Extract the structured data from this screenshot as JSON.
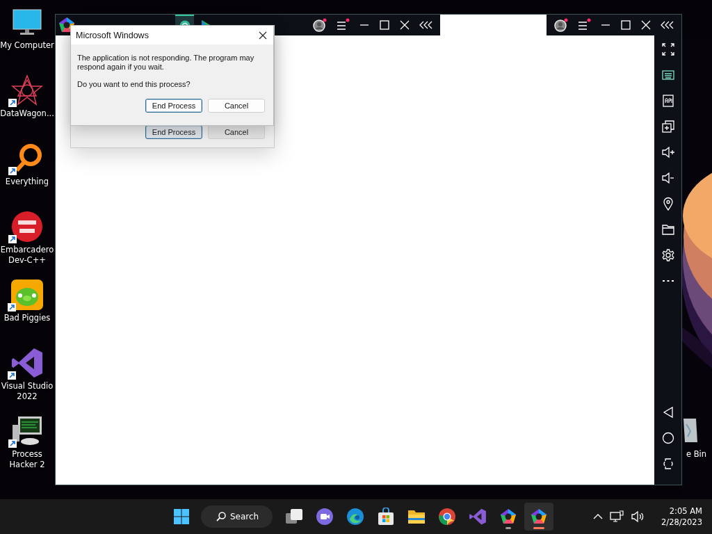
{
  "desktop_icons": [
    {
      "kind": "computer",
      "label": "My Computer",
      "shortcut": false
    },
    {
      "kind": "star",
      "label": "DataWagon...",
      "shortcut": true
    },
    {
      "kind": "magnifier",
      "label": "Everything",
      "shortcut": true
    },
    {
      "kind": "devcpp",
      "label": "Embarcadero Dev-C++",
      "shortcut": true
    },
    {
      "kind": "pig",
      "label": "Bad Piggies",
      "shortcut": true
    },
    {
      "kind": "vs",
      "label": "Visual Studio 2022",
      "shortcut": true
    },
    {
      "kind": "monitor",
      "label": "Process Hacker 2",
      "shortcut": true
    }
  ],
  "recycle_bin": {
    "label": "e Bin"
  },
  "emulator": {
    "tabs": [
      {
        "kind": "app",
        "selected": true
      },
      {
        "kind": "store",
        "selected": false
      }
    ],
    "notifications": {
      "account": true,
      "menu": true
    }
  },
  "dialog": {
    "title": "Microsoft Windows",
    "message": [
      "The application is not responding. The program may respond again if you wait.",
      "Do you want to end this process?"
    ],
    "buttons": [
      {
        "label": "End Process",
        "default": true
      },
      {
        "label": "Cancel",
        "default": false
      }
    ]
  },
  "ghost_dialog": {
    "buttons": [
      {
        "label": "End Process",
        "default": true
      },
      {
        "label": "Cancel",
        "default": false
      }
    ]
  },
  "taskbar": {
    "search": "Search",
    "apps": [
      {
        "kind": "taskview",
        "running": false,
        "selected": false
      },
      {
        "kind": "chat",
        "running": false,
        "selected": false
      },
      {
        "kind": "edge",
        "running": false,
        "selected": false
      },
      {
        "kind": "store",
        "running": false,
        "selected": false
      },
      {
        "kind": "explorer",
        "running": false,
        "selected": false
      },
      {
        "kind": "chrome",
        "running": false,
        "selected": false
      },
      {
        "kind": "vs",
        "running": false,
        "selected": false
      },
      {
        "kind": "memu-multi",
        "running": true,
        "selected": false
      },
      {
        "kind": "memu",
        "running": true,
        "selected": true
      }
    ],
    "time": "2:05 AM",
    "date": "2/28/2023"
  }
}
